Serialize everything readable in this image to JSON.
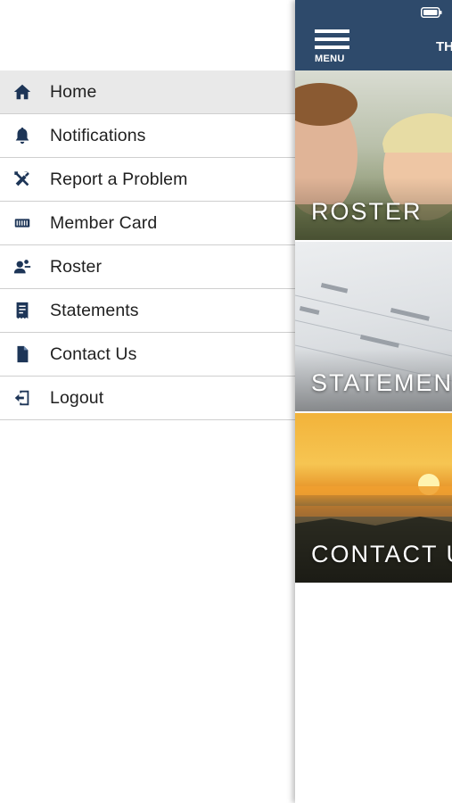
{
  "side_menu": {
    "items": [
      {
        "label": "Home",
        "icon": "home-icon",
        "active": true
      },
      {
        "label": "Notifications",
        "icon": "bell-icon",
        "active": false
      },
      {
        "label": "Report a Problem",
        "icon": "tools-icon",
        "active": false
      },
      {
        "label": "Member Card",
        "icon": "member-card-icon",
        "active": false
      },
      {
        "label": "Roster",
        "icon": "roster-icon",
        "active": false
      },
      {
        "label": "Statements",
        "icon": "statements-icon",
        "active": false
      },
      {
        "label": "Contact Us",
        "icon": "document-icon",
        "active": false
      },
      {
        "label": "Logout",
        "icon": "logout-icon",
        "active": false
      }
    ]
  },
  "top_bar": {
    "menu_label": "MENU",
    "title": "TH"
  },
  "tiles": [
    {
      "label": "ROSTER"
    },
    {
      "label": "STATEMEN"
    },
    {
      "label": "CONTACT U"
    }
  ],
  "colors": {
    "header_bg": "#2e4a6b",
    "icon_color": "#1d3557",
    "active_row_bg": "#e9e9e9"
  }
}
